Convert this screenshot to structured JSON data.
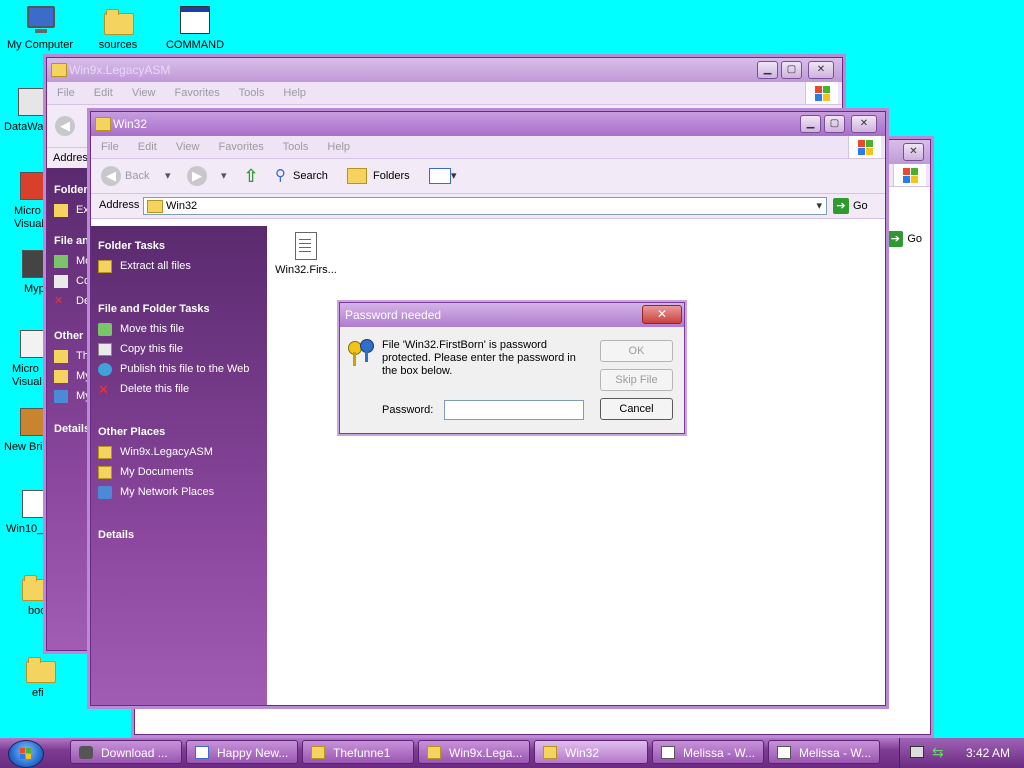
{
  "desktop": {
    "icons": [
      {
        "label": "My Computer"
      },
      {
        "label": "sources"
      },
      {
        "label": "COMMAND"
      },
      {
        "label": "DataWa"
      },
      {
        "label": "Micro Visual"
      },
      {
        "label": "Myp"
      },
      {
        "label": "Micro Visual"
      },
      {
        "label": "New Bri"
      },
      {
        "label": "Win10_"
      },
      {
        "label": "boo"
      },
      {
        "label": "efi"
      }
    ]
  },
  "window_back": {
    "title": "Win9x.LegacyASM",
    "menu": [
      "File",
      "Edit",
      "View",
      "Favorites",
      "Tools",
      "Help"
    ],
    "address_label": "Addres",
    "taskpane": {
      "folder_label": "Folder",
      "extract": "Ext",
      "file_label": "File an",
      "items": [
        "Mo",
        "Co",
        "De"
      ],
      "other_label": "Other I",
      "other_items": [
        "Th",
        "My",
        "My"
      ],
      "details": "Details"
    }
  },
  "window_third": {
    "go": "Go"
  },
  "window_main": {
    "title": "Win32",
    "menu": [
      "File",
      "Edit",
      "View",
      "Favorites",
      "Tools",
      "Help"
    ],
    "toolbar": {
      "back": "Back",
      "search": "Search",
      "folders": "Folders"
    },
    "address": {
      "label": "Address",
      "value": "Win32",
      "go": "Go"
    },
    "taskpane": {
      "folder_tasks_title": "Folder Tasks",
      "folder_tasks": [
        "Extract all files"
      ],
      "file_tasks_title": "File and Folder Tasks",
      "file_tasks": [
        "Move this file",
        "Copy this file",
        "Publish this file to the Web",
        "Delete this file"
      ],
      "other_places_title": "Other Places",
      "other_places": [
        "Win9x.LegacyASM",
        "My Documents",
        "My Network Places"
      ],
      "details_title": "Details"
    },
    "files": [
      {
        "name": "Win32.Firs..."
      }
    ]
  },
  "dialog": {
    "title": "Password needed",
    "message": "File 'Win32.FirstBorn' is password protected.  Please enter the password in the box below.",
    "password_label": "Password:",
    "password_value": "",
    "ok": "OK",
    "skip": "Skip File",
    "cancel": "Cancel"
  },
  "taskbar": {
    "tasks": [
      {
        "label": "Download ...",
        "active": false
      },
      {
        "label": "Happy New...",
        "active": false
      },
      {
        "label": "Thefunne1",
        "active": false
      },
      {
        "label": "Win9x.Lega...",
        "active": false
      },
      {
        "label": "Win32",
        "active": true
      },
      {
        "label": "Melissa - W...",
        "active": false
      },
      {
        "label": "Melissa - W...",
        "active": false
      }
    ],
    "clock": "3:42 AM"
  },
  "colors": {
    "desktop": "#00ffff",
    "title_active": "#a86ec9",
    "taskpane": "#5a2a6e"
  }
}
